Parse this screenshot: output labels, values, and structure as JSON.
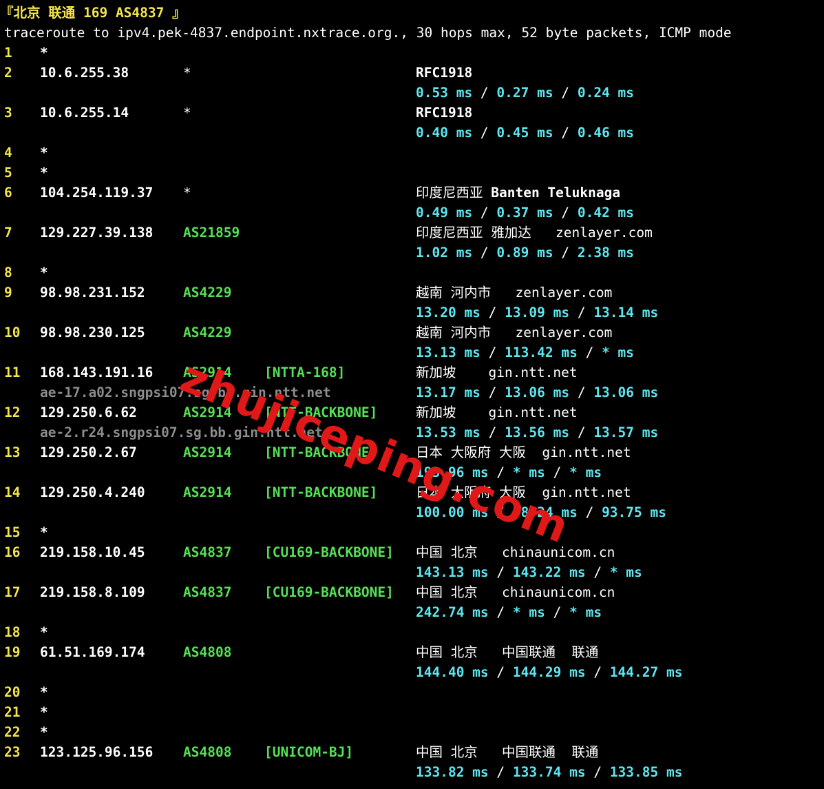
{
  "terminal": {
    "title_text": "『北京 联通 169 AS4837 』",
    "command_header": "traceroute to ipv4.pek-4837.endpoint.nxtrace.org., 30 hops max, 52 byte packets, ICMP mode",
    "watermark": "zhujiceping.com"
  },
  "hops": [
    {
      "n": "1",
      "star": "*"
    },
    {
      "n": "2",
      "ip": "10.6.255.38",
      "as": "*",
      "geo": "RFC1918",
      "geo_bold": true,
      "rtt": [
        "0.53 ms",
        "0.27 ms",
        "0.24 ms"
      ]
    },
    {
      "n": "3",
      "ip": "10.6.255.14",
      "as": "*",
      "geo": "RFC1918",
      "geo_bold": true,
      "rtt": [
        "0.40 ms",
        "0.45 ms",
        "0.46 ms"
      ]
    },
    {
      "n": "4",
      "star": "*"
    },
    {
      "n": "5",
      "star": "*"
    },
    {
      "n": "6",
      "ip": "104.254.119.37",
      "as": "*",
      "geo": "印度尼西亚 ",
      "geo2": "Banten Teluknaga",
      "rtt": [
        "0.49 ms",
        "0.37 ms",
        "0.42 ms"
      ]
    },
    {
      "n": "7",
      "ip": "129.227.39.138",
      "as": "AS21859",
      "geo": "印度尼西亚 雅加达   zenlayer.com",
      "rtt": [
        "1.02 ms",
        "0.89 ms",
        "2.38 ms"
      ]
    },
    {
      "n": "8",
      "star": "*"
    },
    {
      "n": "9",
      "ip": "98.98.231.152",
      "as": "AS4229",
      "geo": "越南 河内市   zenlayer.com",
      "rtt": [
        "13.20 ms",
        "13.09 ms",
        "13.14 ms"
      ]
    },
    {
      "n": "10",
      "ip": "98.98.230.125",
      "as": "AS4229",
      "geo": "越南 河内市   zenlayer.com",
      "rtt": [
        "13.13 ms",
        "113.42 ms",
        "* ms"
      ]
    },
    {
      "n": "11",
      "ip": "168.143.191.16",
      "as": "AS2914",
      "net": "[NTTA-168]",
      "geo": "新加坡    gin.ntt.net",
      "rdns": "ae-17.a02.sngpsi07.sg.bb.gin.ntt.net",
      "rtt": [
        "13.17 ms",
        "13.06 ms",
        "13.06 ms"
      ]
    },
    {
      "n": "12",
      "ip": "129.250.6.62",
      "as": "AS2914",
      "net": "[NTT-BACKBONE]",
      "geo": "新加坡    gin.ntt.net",
      "rdns": "ae-2.r24.sngpsi07.sg.bb.gin.ntt.net",
      "rtt": [
        "13.53 ms",
        "13.56 ms",
        "13.57 ms"
      ]
    },
    {
      "n": "13",
      "ip": "129.250.2.67",
      "as": "AS2914",
      "net": "[NTT-BACKBONE]",
      "geo": "日本 大阪府 大阪  gin.ntt.net",
      "rtt": [
        "193.96 ms",
        "* ms",
        "* ms"
      ]
    },
    {
      "n": "14",
      "ip": "129.250.4.240",
      "as": "AS2914",
      "net": "[NTT-BACKBONE]",
      "geo": "日本 大阪府 大阪  gin.ntt.net",
      "rtt": [
        "100.00 ms",
        "98.24 ms",
        "93.75 ms"
      ]
    },
    {
      "n": "15",
      "star": "*"
    },
    {
      "n": "16",
      "ip": "219.158.10.45",
      "as": "AS4837",
      "net": "[CU169-BACKBONE]",
      "geo": "中国 北京   chinaunicom.cn",
      "rtt": [
        "143.13 ms",
        "143.22 ms",
        "* ms"
      ]
    },
    {
      "n": "17",
      "ip": "219.158.8.109",
      "as": "AS4837",
      "net": "[CU169-BACKBONE]",
      "geo": "中国 北京   chinaunicom.cn",
      "rtt": [
        "242.74 ms",
        "* ms",
        "* ms"
      ]
    },
    {
      "n": "18",
      "star": "*"
    },
    {
      "n": "19",
      "ip": "61.51.169.174",
      "as": "AS4808",
      "geo": "中国 北京   中国联通  联通",
      "rtt": [
        "144.40 ms",
        "144.29 ms",
        "144.27 ms"
      ]
    },
    {
      "n": "20",
      "star": "*"
    },
    {
      "n": "21",
      "star": "*"
    },
    {
      "n": "22",
      "star": "*"
    },
    {
      "n": "23",
      "ip": "123.125.96.156",
      "as": "AS4808",
      "net": "[UNICOM-BJ]",
      "geo": "中国 北京   中国联通  联通",
      "rtt": [
        "133.82 ms",
        "133.74 ms",
        "133.85 ms"
      ]
    }
  ],
  "colors": {
    "background": "#000000",
    "hop_number": "#f4e54c",
    "asn": "#55e055",
    "rtt": "#5ee6f0",
    "rdns": "#8c8c8c",
    "watermark": "#e01818"
  }
}
